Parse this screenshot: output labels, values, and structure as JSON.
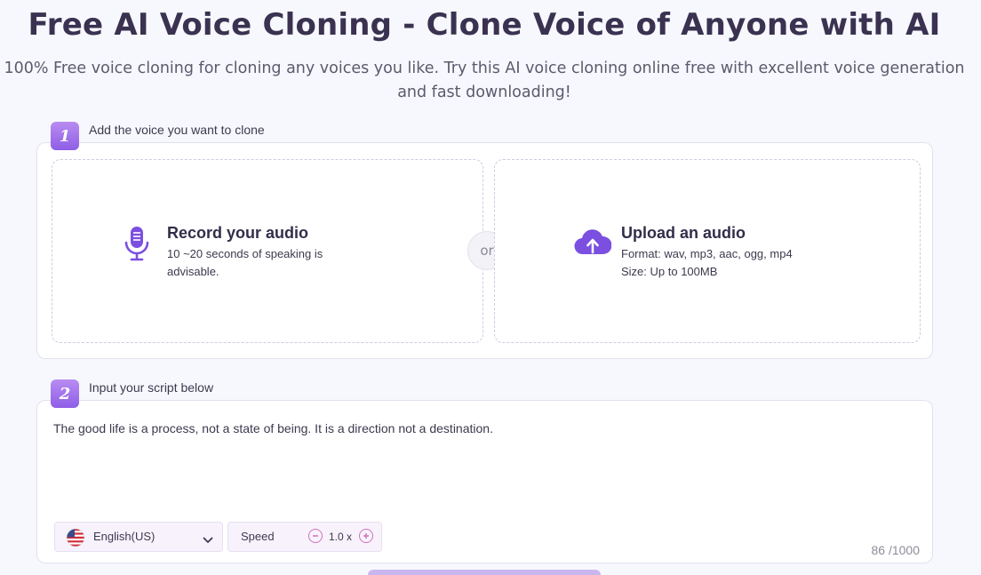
{
  "header": {
    "title": "Free AI Voice Cloning - Clone Voice of Anyone with AI",
    "subtitle_line1": "100% Free voice cloning for cloning any voices you like. Try this AI voice cloning online free with excellent voice generation",
    "subtitle_line2": "and fast downloading!"
  },
  "step1": {
    "number": "1",
    "label": "Add the voice you want to clone",
    "record": {
      "icon": "microphone-icon",
      "title": "Record your audio",
      "desc_line1": "10 ~20 seconds of speaking is",
      "desc_line2": "advisable."
    },
    "or_text": "or",
    "upload": {
      "icon": "cloud-upload-icon",
      "title": "Upload an audio",
      "format": "Format: wav, mp3, aac, ogg, mp4",
      "size": "Size: Up to 100MB"
    }
  },
  "step2": {
    "number": "2",
    "label": "Input your script below",
    "script": "The good life is a process, not a state of being. It is a direction not a destination.",
    "language": {
      "icon": "us-flag-icon",
      "value": "English(US)"
    },
    "speed": {
      "label": "Speed",
      "value": "1.0 x"
    },
    "counter": "86 /1000"
  },
  "colors": {
    "accent": "#8e5ee6",
    "icon_purple": "#7b4fe0",
    "speed_pink": "#d071b7"
  }
}
